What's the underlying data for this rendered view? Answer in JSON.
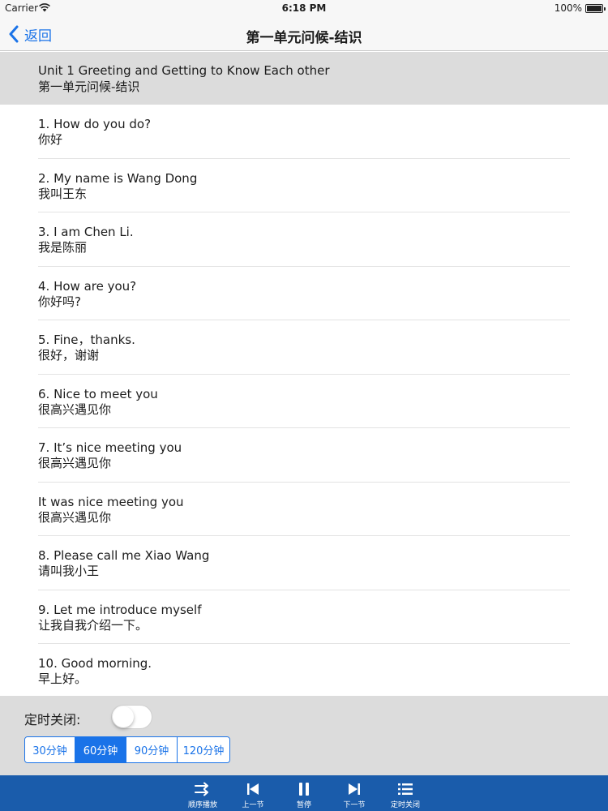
{
  "status_bar": {
    "carrier": "Carrier",
    "time": "6:18 PM",
    "battery": "100%"
  },
  "nav": {
    "back_label": "返回",
    "title": "第一单元问候-结识"
  },
  "unit": {
    "title_en": "Unit 1  Greeting and Getting to Know Each other",
    "title_zh": "第一单元问候-结识"
  },
  "lessons": [
    {
      "en": "1.  How do you do?",
      "zh": "你好"
    },
    {
      "en": "2.  My name is Wang Dong",
      "zh": "我叫王东"
    },
    {
      "en": "3.  I am Chen Li.",
      "zh": "我是陈丽"
    },
    {
      "en": "4.  How are you?",
      "zh": "你好吗?"
    },
    {
      "en": "5.  Fine，thanks.",
      "zh": "很好，谢谢"
    },
    {
      "en": "6.  Nice to meet you",
      "zh": "很高兴遇见你"
    },
    {
      "en": "7.  It’s nice meeting you",
      "zh": "很高兴遇见你"
    },
    {
      "en": "It was nice meeting you",
      "zh": "很高兴遇见你"
    },
    {
      "en": "8.  Please call me Xiao Wang",
      "zh": "请叫我小王"
    },
    {
      "en": "9.  Let me introduce myself",
      "zh": "让我自我介绍一下。"
    },
    {
      "en": "10.  Good morning.",
      "zh": "早上好。"
    }
  ],
  "timer": {
    "label": "定时关闭:",
    "enabled": false,
    "options": [
      "30分钟",
      "60分钟",
      "90分钟",
      "120分钟"
    ],
    "selected": "60分钟"
  },
  "toolbar": {
    "order_play": "顺序播放",
    "previous": "上一节",
    "pause": "暂停",
    "next": "下一节",
    "timer_off": "定时关闭"
  },
  "colors": {
    "accent": "#1a73e8",
    "toolbar_bg": "#1a5cab",
    "header_bg": "#dcdcdc"
  }
}
